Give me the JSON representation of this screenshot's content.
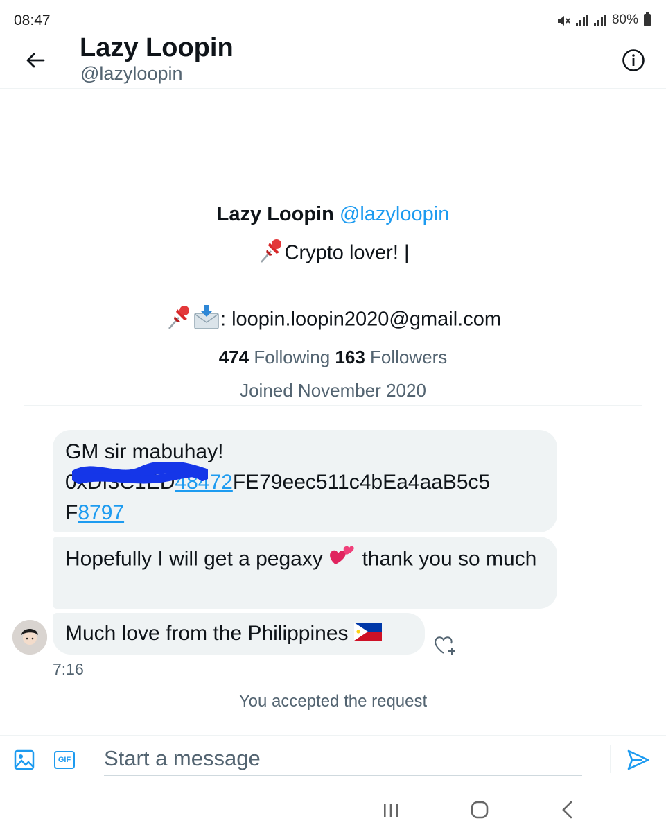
{
  "status_bar": {
    "time": "08:47",
    "battery": "80%"
  },
  "header": {
    "name": "Lazy Loopin",
    "handle": "@lazyloopin"
  },
  "profile": {
    "name": "Lazy Loopin",
    "handle": "@lazyloopin",
    "bio_line1": "Crypto lover!  |",
    "bio_line2": ": loopin.loopin2020@gmail.com",
    "following_count": "474",
    "following_label": "Following",
    "followers_count": "163",
    "followers_label": "Followers",
    "joined": "Joined November 2020"
  },
  "messages": [
    {
      "line1": "GM sir mabuhay!",
      "address_hidden": "0xDf3C1",
      "address_hidden2": "ED",
      "address_link1": "48472",
      "address_rest": "FE79eec511c4bEa4aaB5c5",
      "address_prefix2": "F",
      "address_link2": "8797"
    },
    {
      "text_before": "Hopefully I will get a pegaxy ",
      "text_after": " thank you so much"
    },
    {
      "text": "Much love from the Philippines "
    }
  ],
  "message_time": "7:16",
  "accepted_text": "You accepted the request",
  "composer": {
    "placeholder": "Start a message",
    "gif_label": "GIF"
  },
  "icons": {
    "back": "arrow-left-icon",
    "info": "info-icon",
    "pin": "pushpin-icon",
    "envelope": "envelope-icon",
    "hearts": "two-hearts-icon",
    "flag": "philippines-flag-icon",
    "react": "heart-plus-icon",
    "media": "image-icon",
    "send": "send-icon"
  },
  "colors": {
    "accent": "#1d9bf0",
    "text_primary": "#0f1419",
    "text_secondary": "#536471",
    "bubble": "#eff3f4",
    "scribble": "#1536e8"
  }
}
